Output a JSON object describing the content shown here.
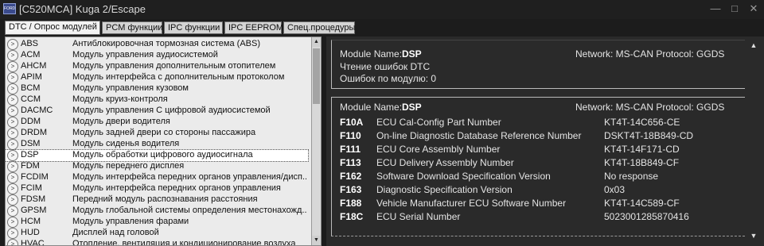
{
  "window": {
    "title": "[C520MCA] Kuga 2/Escape",
    "icon_text": "FORD",
    "minimize": "—",
    "maximize": "□",
    "close": "✕"
  },
  "tabs": [
    {
      "label": "DTC / Опрос модулей",
      "active": true
    },
    {
      "label": "PCM функции"
    },
    {
      "label": "IPC функции"
    },
    {
      "label": "IPC EEPROM"
    },
    {
      "label": "Спец.процедуры"
    }
  ],
  "modules": [
    {
      "code": "ABS",
      "desc": "Антиблокировочная тормозная система (ABS)"
    },
    {
      "code": "ACM",
      "desc": "Модуль управления аудиосистемой"
    },
    {
      "code": "AHCM",
      "desc": "Модуль управления дополнительным отопителем"
    },
    {
      "code": "APIM",
      "desc": "Модуль интерфейса с дополнительным протоколом"
    },
    {
      "code": "BCM",
      "desc": "Модуль управления кузовом"
    },
    {
      "code": "CCM",
      "desc": "Модуль круиз-контроля"
    },
    {
      "code": "DACMC",
      "desc": "Модуль управления С цифровой аудиосистемой"
    },
    {
      "code": "DDM",
      "desc": "Модуль двери водителя"
    },
    {
      "code": "DRDM",
      "desc": "Модуль задней двери со стороны пассажира"
    },
    {
      "code": "DSM",
      "desc": "Модуль сиденья водителя"
    },
    {
      "code": "DSP",
      "desc": "Модуль обработки цифрового аудиосигнала",
      "selected": true
    },
    {
      "code": "FDM",
      "desc": "Модуль переднего дисплея"
    },
    {
      "code": "FCDIM",
      "desc": "Модуль интерфейса передних органов управления/дисп..."
    },
    {
      "code": "FCIM",
      "desc": "Модуль интерфейса передних органов управления"
    },
    {
      "code": "FDSM",
      "desc": "Передний модуль распознавания расстояния"
    },
    {
      "code": "GPSM",
      "desc": "Модуль глобальной системы определения местонахожд..."
    },
    {
      "code": "HCM",
      "desc": "Модуль управления фарами"
    },
    {
      "code": "HUD",
      "desc": "Дисплей над головой"
    },
    {
      "code": "HVAC",
      "desc": "Отопление, вентиляция и кондиционирование воздуха"
    }
  ],
  "dtc_box": {
    "module_label": "Module Name:",
    "module_name": "DSP",
    "network": "Network: MS-CAN Protocol: GGDS",
    "line1": "Чтение ошибок DTC",
    "line2": "Ошибок по модулю: 0"
  },
  "info_box": {
    "module_label": "Module Name:",
    "module_name": "DSP",
    "network": "Network: MS-CAN Protocol: GGDS",
    "rows": [
      {
        "did": "F10A",
        "name": "ECU Cal-Config Part Number",
        "value": "KT4T-14C656-CE"
      },
      {
        "did": "F110",
        "name": "On-line Diagnostic Database Reference Number",
        "value": "DSKT4T-18B849-CD"
      },
      {
        "did": "F111",
        "name": "ECU Core Assembly Number",
        "value": "KT4T-14F171-CD"
      },
      {
        "did": "F113",
        "name": "ECU Delivery Assembly Number",
        "value": "KT4T-18B849-CF"
      },
      {
        "did": "F162",
        "name": "Software Download Specification Version",
        "value": "No response"
      },
      {
        "did": "F163",
        "name": "Diagnostic Specification Version",
        "value": "0x03"
      },
      {
        "did": "F188",
        "name": "Vehicle Manufacturer ECU Software Number",
        "value": "KT4T-14C589-CF"
      },
      {
        "did": "F18C",
        "name": "ECU Serial Number",
        "value": "5023001285870416"
      }
    ]
  },
  "scroll": {
    "up": "▲",
    "down": "▼"
  }
}
